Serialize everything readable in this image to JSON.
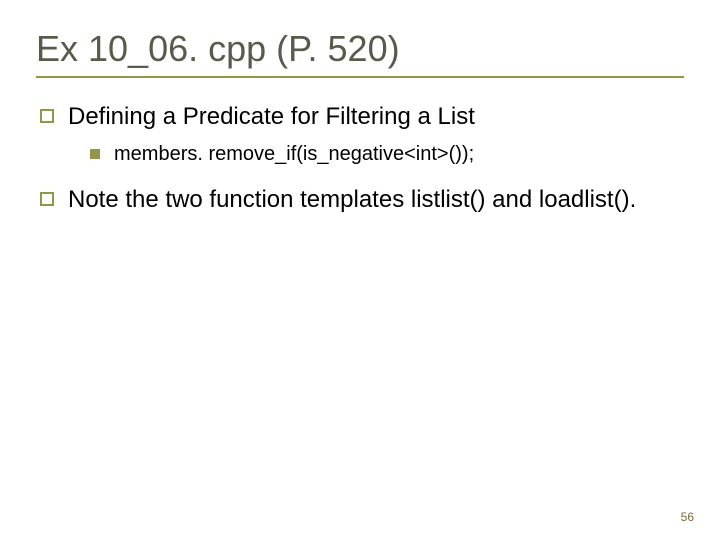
{
  "title": "Ex 10_06. cpp (P. 520)",
  "bullets": [
    {
      "text": "Defining a Predicate for Filtering a List",
      "sub": [
        {
          "text": "members. remove_if(is_negative<int>());"
        }
      ]
    },
    {
      "text": "Note the two function templates listlist() and loadlist().",
      "sub": []
    }
  ],
  "page_number": "56"
}
